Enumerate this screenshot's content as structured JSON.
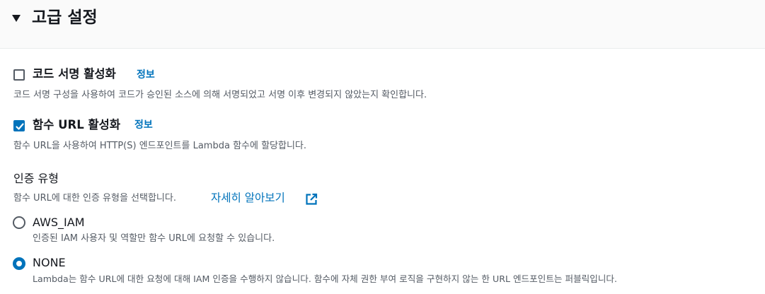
{
  "advanced": {
    "title": "고급 설정"
  },
  "code_signing": {
    "title": "코드 서명 활성화",
    "info": "정보",
    "description": "코드 서명 구성을 사용하여 코드가 승인된 소스에 의해 서명되었고 서명 이후 변경되지 않았는지 확인합니다.",
    "checked": false
  },
  "function_url": {
    "title": "함수 URL 활성화",
    "info": "정보",
    "description": "함수 URL을 사용하여 HTTP(S) 엔드포인트를 Lambda 함수에 할당합니다.",
    "checked": true
  },
  "auth_type": {
    "label": "인증 유형",
    "description": "함수 URL에 대한 인증 유형을 선택합니다.",
    "learn_more": "자세히 알아보기",
    "options": [
      {
        "label": "AWS_IAM",
        "description": "인증된 IAM 사용자 및 역할만 함수 URL에 요청할 수 있습니다.",
        "selected": false
      },
      {
        "label": "NONE",
        "description": "Lambda는 함수 URL에 대한 요청에 대해 IAM 인증을 수행하지 않습니다. 함수에 자체 권한 부여 로직을 구현하지 않는 한 URL 엔드포인트는 퍼블릭입니다.",
        "selected": true
      }
    ]
  },
  "colors": {
    "link": "#0073bb",
    "checked": "#0073bb",
    "text": "#16191f",
    "muted": "#545b64",
    "header_bg": "#fafafa"
  }
}
